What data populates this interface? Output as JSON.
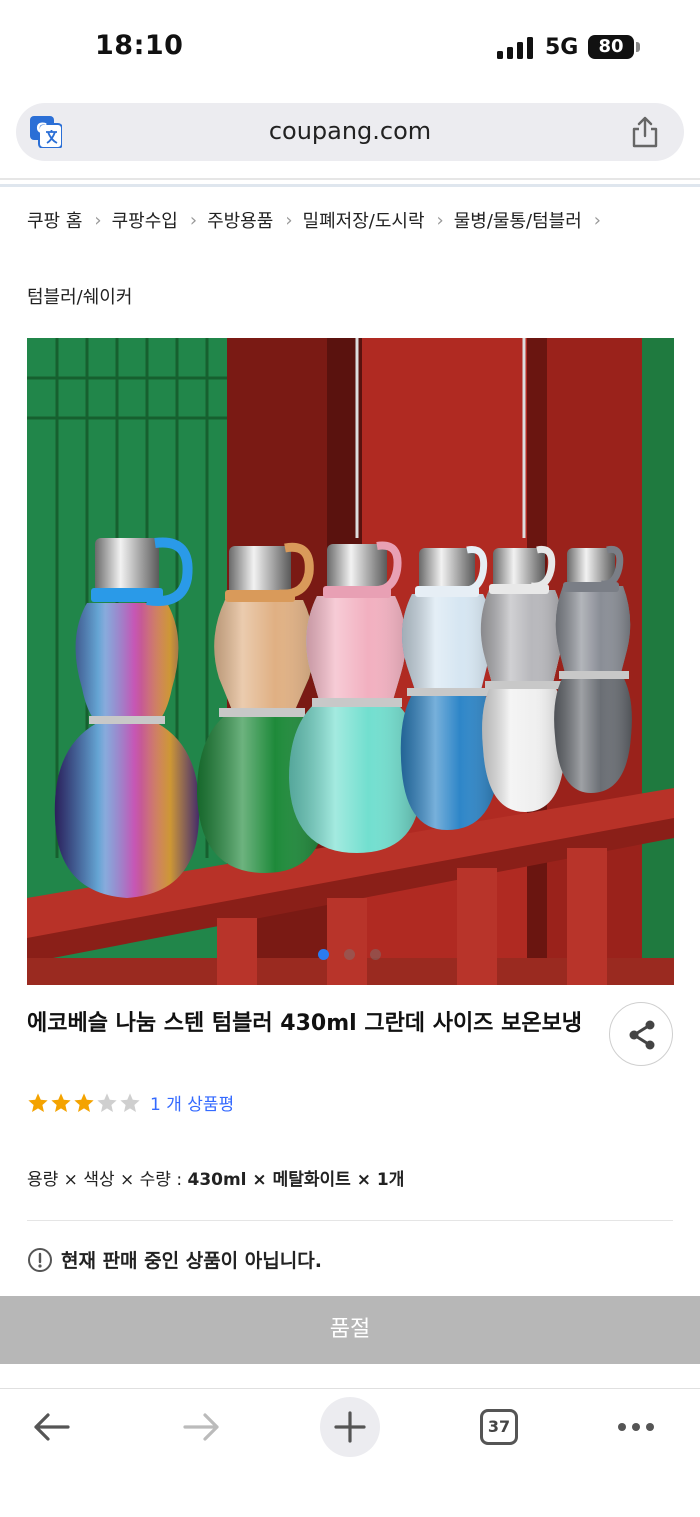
{
  "status_bar": {
    "time": "18:10",
    "network": "5G",
    "battery": "80"
  },
  "browser": {
    "url": "coupang.com",
    "open_tabs": "37"
  },
  "breadcrumb": {
    "items": [
      "쿠팡 홈",
      "쿠팡수입",
      "주방용품",
      "밀폐저장/도시락",
      "물병/물통/텀블러"
    ],
    "last": "텀블러/쉐이커"
  },
  "gallery": {
    "current_slide": 1,
    "slides": 3
  },
  "product": {
    "title": "에코베슬 나눔 스텐 텀블러 430ml 그란데 사이즈 보온보냉",
    "rating": 3,
    "rating_max": 5,
    "review_text": "1 개 상품평",
    "option_label": "용량 × 색상 × 수량 : ",
    "option_value": "430ml × 메탈화이트 × 1개",
    "notice": "현재 판매 중인 상품이 아닙니다.",
    "soldout_label": "품절"
  },
  "colors": {
    "accent_blue": "#346aff",
    "star_filled": "#f4a300",
    "star_empty": "#cfcfcf",
    "soldout_bg": "#b7b7b7"
  },
  "icons": [
    "translate-icon",
    "share-icon",
    "back-arrow-icon",
    "forward-arrow-icon",
    "plus-icon",
    "tabs-icon",
    "more-icon",
    "alert-circle-icon",
    "star-icon"
  ]
}
